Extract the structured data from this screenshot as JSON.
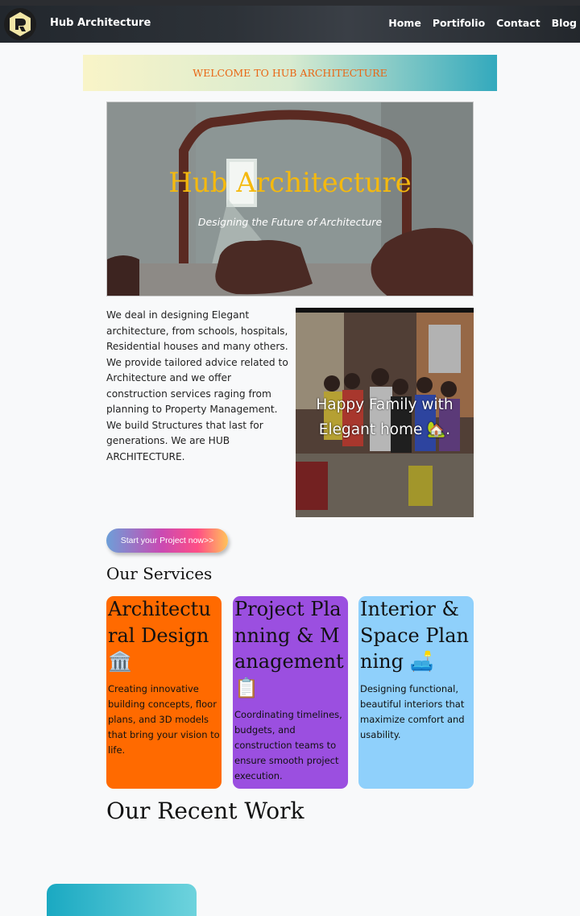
{
  "navbar": {
    "brand": "Hub Architecture",
    "links": [
      "Home",
      "Portifolio",
      "Contact",
      "Blog"
    ]
  },
  "welcome": "WELCOME TO HUB ARCHITECTURE",
  "hero": {
    "title": "Hub Architecture",
    "subtitle": "Designing the Future of Architecture"
  },
  "intro": "We deal in designing Elegant architecture, from schools, hospitals, Residential houses and many others. We provide tailored advice related to Architecture and we offer construction services raging from planning to Property Management. We build Structures that last for generations. We are HUB ARCHITECTURE.",
  "photo_caption": "Happy Family with Elegant home 🏡.",
  "cta_label": "Start your Project now>>",
  "services": {
    "heading": "Our Services",
    "cards": [
      {
        "title": "Architectural Design 🏛️",
        "desc": "Creating innovative building concepts, floor plans, and 3D models that bring your vision to life.",
        "color": "#ff6a00"
      },
      {
        "title": "Project Planning & Management 📋",
        "desc": "Coordinating timelines, budgets, and construction teams to ensure smooth project execution.",
        "color": "#9b4fe0"
      },
      {
        "title": "Interior & Space Planning 🛋️",
        "desc": "Designing functional, beautiful interiors that maximize comfort and usability.",
        "color": "#8fd0fb"
      }
    ]
  },
  "recent_heading": "Our Recent Work",
  "colors": {
    "accent": "#f5b90e",
    "welcome_text": "#e96614"
  }
}
